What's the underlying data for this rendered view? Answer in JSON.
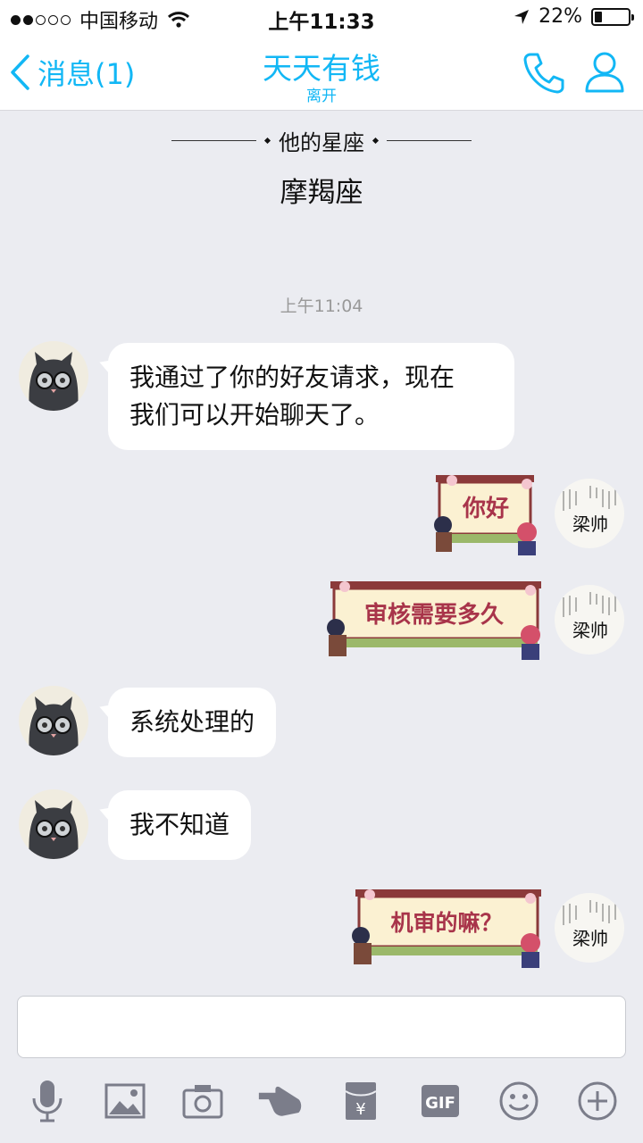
{
  "status_bar": {
    "carrier": "中国移动",
    "time": "上午11:33",
    "battery_percent": "22%",
    "battery_level": 0.22,
    "signal_bars_filled": 2,
    "signal_bars_total": 5
  },
  "nav": {
    "back_label": "消息(1)",
    "title": "天天有钱",
    "subtitle": "离开"
  },
  "profile_card": {
    "label": "他的星座",
    "value": "摩羯座"
  },
  "chat": {
    "timestamp": "上午11:04",
    "messages": [
      {
        "side": "in",
        "type": "text",
        "line1": "我通过了你的好友请求，现在",
        "line2": "我们可以开始聊天了。"
      },
      {
        "side": "out",
        "type": "sticker",
        "text": "你好"
      },
      {
        "side": "out",
        "type": "sticker",
        "text": "审核需要多久"
      },
      {
        "side": "in",
        "type": "text",
        "line1": "系统处理的"
      },
      {
        "side": "in",
        "type": "text",
        "line1": "我不知道"
      },
      {
        "side": "out",
        "type": "sticker",
        "text": "机审的嘛？"
      }
    ],
    "my_avatar_text": "梁帅"
  },
  "input": {
    "placeholder": ""
  },
  "toolbar": {
    "icons": [
      "microphone-icon",
      "image-icon",
      "camera-icon",
      "poke-icon",
      "red-packet-icon",
      "gif-icon",
      "emoji-icon",
      "plus-icon"
    ],
    "gif_label": "GIF",
    "red_packet_label": "¥"
  },
  "colors": {
    "accent": "#12b7f5",
    "background": "#ebecf1",
    "bubble": "#ffffff",
    "toolbar_icon": "#7b7d8a",
    "sticker_text": "#a8344a"
  }
}
